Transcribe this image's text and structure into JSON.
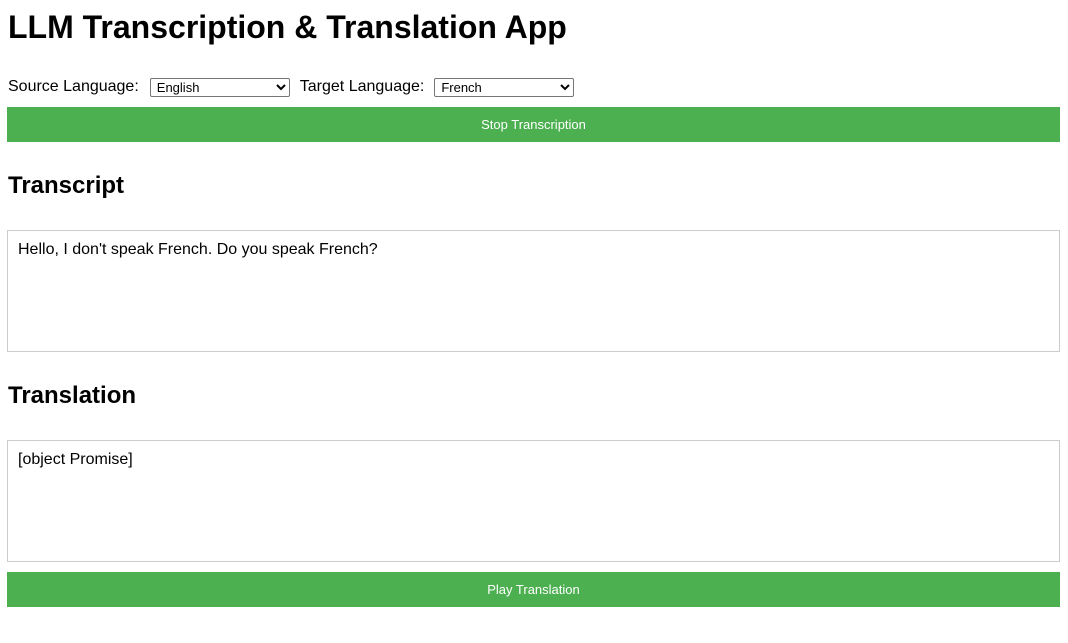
{
  "app": {
    "title": "LLM Transcription & Translation App"
  },
  "languages": {
    "source_label": "Source Language:",
    "source_selected": "English",
    "target_label": "Target Language:",
    "target_selected": "French"
  },
  "controls": {
    "stop_label": "Stop Transcription",
    "play_label": "Play Translation"
  },
  "transcript": {
    "heading": "Transcript",
    "text": "Hello, I don't speak French. Do you speak French?"
  },
  "translation": {
    "heading": "Translation",
    "text": "[object Promise]"
  },
  "colors": {
    "button_bg": "#4caf50",
    "button_text": "#ffffff",
    "box_border": "#cccccc"
  }
}
